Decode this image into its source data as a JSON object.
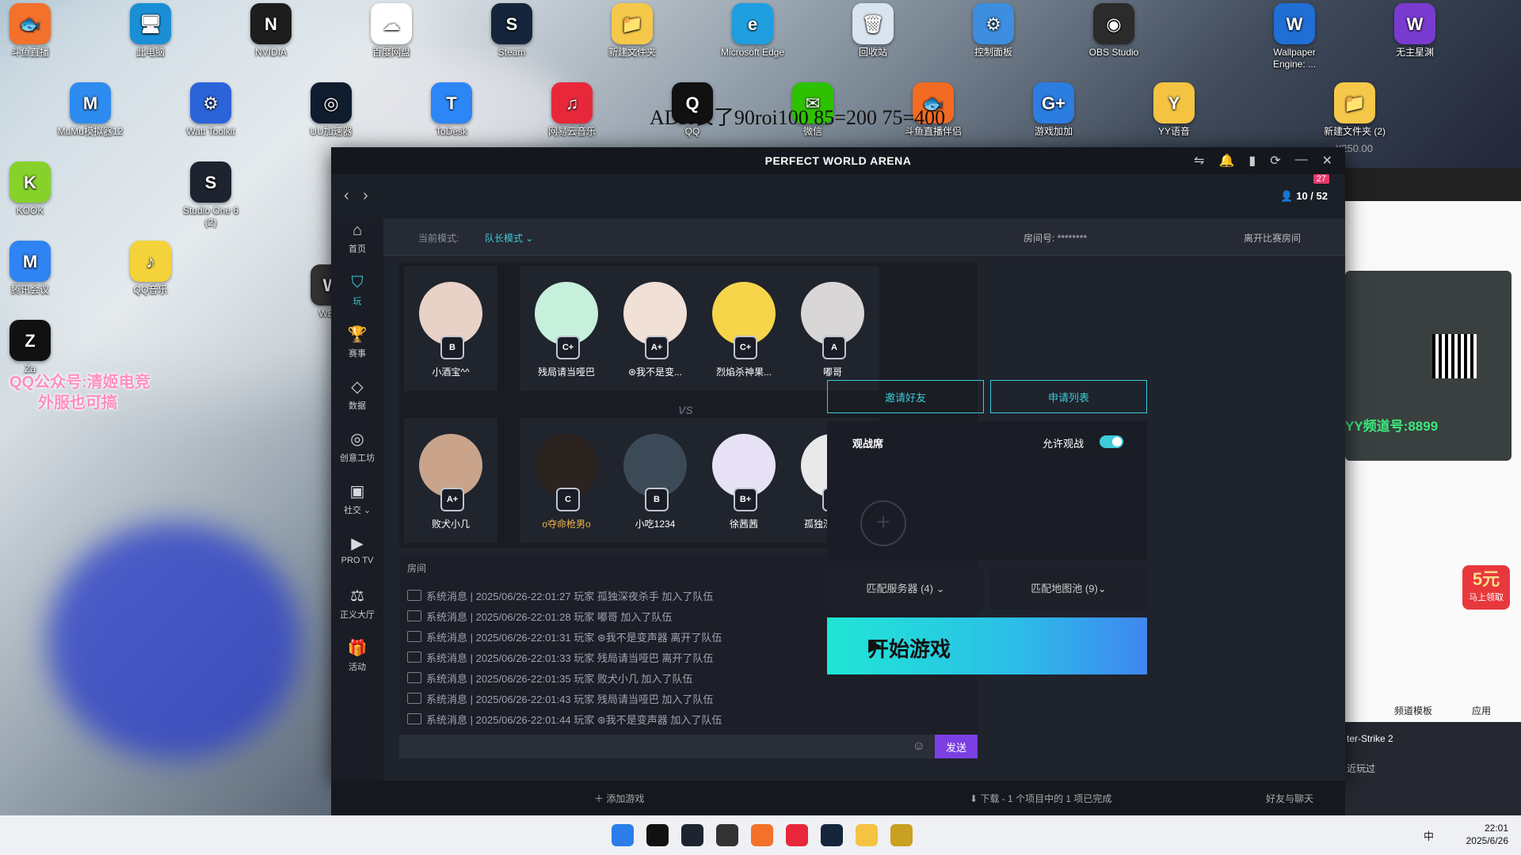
{
  "desktop": {
    "icons": [
      {
        "label": "斗鱼直播",
        "glyph": "🐟",
        "color": "#f3712b"
      },
      {
        "label": "此电脑",
        "glyph": "🖥",
        "color": "#1a8fd6"
      },
      {
        "label": "NVIDIA",
        "glyph": "N",
        "color": "#1d1d1d"
      },
      {
        "label": "百度网盘",
        "glyph": "☁",
        "color": "#ffffff"
      },
      {
        "label": "Steam",
        "glyph": "S",
        "color": "#15253b"
      },
      {
        "label": "新建文件夹",
        "glyph": "📁",
        "color": "#f5c84a"
      },
      {
        "label": "Microsoft Edge",
        "glyph": "e",
        "color": "#1f9ee0"
      },
      {
        "label": "回收站",
        "glyph": "🗑",
        "color": "#d8e4ef"
      },
      {
        "label": "控制面板",
        "glyph": "⚙",
        "color": "#3d8de0"
      },
      {
        "label": "OBS Studio",
        "glyph": "◉",
        "color": "#2b2b2b"
      },
      {
        "label": "Wallpaper Engine: ...",
        "glyph": "W",
        "color": "#1f6fd6"
      },
      {
        "label": "无主星渊",
        "glyph": "W",
        "color": "#7a3bd1"
      },
      {
        "label": "MuMu模拟器12",
        "glyph": "M",
        "color": "#2e8bf0"
      },
      {
        "label": "Watt Toolkit",
        "glyph": "⚙",
        "color": "#2b63d9"
      },
      {
        "label": "UU加速器",
        "glyph": "◎",
        "color": "#0f1c2e"
      },
      {
        "label": "ToDesk",
        "glyph": "T",
        "color": "#2c86f5"
      },
      {
        "label": "网易云音乐",
        "glyph": "♫",
        "color": "#e8283a"
      },
      {
        "label": "QQ",
        "glyph": "Q",
        "color": "#111111"
      },
      {
        "label": "微信",
        "glyph": "✉",
        "color": "#2dc100"
      },
      {
        "label": "斗鱼直播伴侣",
        "glyph": "🐟",
        "color": "#f36b22"
      },
      {
        "label": "游戏加加",
        "glyph": "G+",
        "color": "#2b7de0"
      },
      {
        "label": "YY语音",
        "glyph": "Y",
        "color": "#f5c342"
      },
      {
        "label": "新建文件夹 (2)",
        "glyph": "📁",
        "color": "#f5c84a"
      },
      {
        "label": "KOOK",
        "glyph": "K",
        "color": "#86d22a"
      },
      {
        "label": "Studio One 6 (2)",
        "glyph": "S",
        "color": "#1d2430"
      },
      {
        "label": "腾讯会议",
        "glyph": "M",
        "color": "#2f83f3"
      },
      {
        "label": "QQ音乐",
        "glyph": "♪",
        "color": "#f3d23a"
      },
      {
        "label": "WE博",
        "glyph": "W",
        "color": "#333333"
      },
      {
        "label": "Za",
        "glyph": "Z",
        "color": "#111111"
      }
    ],
    "overlay_text": "ADR长了90roi100 85=200 75=400",
    "watermark_line1": "QQ公众号:清姬电竞",
    "watermark_line2": "外服也可搞"
  },
  "app": {
    "title": "PERFECT WORLD ARENA",
    "online_count": "10 / 52",
    "notify_badge": "27",
    "sidebar": [
      {
        "label": "首页",
        "glyph": "⌂"
      },
      {
        "label": "玩",
        "glyph": "⛉"
      },
      {
        "label": "赛事",
        "glyph": "🏆"
      },
      {
        "label": "数据",
        "glyph": "◇"
      },
      {
        "label": "创意工坊",
        "glyph": "◎"
      },
      {
        "label": "社交 ⌄",
        "glyph": "▣"
      },
      {
        "label": "PRO TV",
        "glyph": "▶"
      },
      {
        "label": "正义大厅",
        "glyph": "⚖"
      },
      {
        "label": "活动",
        "glyph": "🎁"
      }
    ],
    "mode_label": "当前模式:",
    "mode_value": "队长模式 ⌄",
    "room_label": "房间号:  ********",
    "leave_label": "离开比赛房间",
    "vs": "VS",
    "team_a": [
      {
        "name": "小酒宝^^",
        "rank": "B",
        "color": "#e8d2c7"
      },
      {
        "name": "残局请当哑巴",
        "rank": "C+",
        "color": "#c6efdc"
      },
      {
        "name": "⊛我不是变...",
        "rank": "A+",
        "color": "#f1e0d6"
      },
      {
        "name": "烈焰杀神果...",
        "rank": "C+",
        "color": "#f6d54a"
      },
      {
        "name": "嘟哥",
        "rank": "A",
        "color": "#d8d6d6"
      }
    ],
    "team_b": [
      {
        "name": "败犬小几",
        "rank": "A+",
        "color": "#c9a48b"
      },
      {
        "name": "o夺命枪男o",
        "rank": "C",
        "color": "#2b2320"
      },
      {
        "name": "小吃1234",
        "rank": "B",
        "color": "#3c4a57"
      },
      {
        "name": "徐茜茜",
        "rank": "B+",
        "color": "#e7e2f6"
      },
      {
        "name": "孤独深夜杀手",
        "rank": "B+",
        "color": "#e9e9ea"
      }
    ],
    "chat_header": "房间",
    "chat": [
      "系统消息 | 2025/06/26-22:01:27 玩家 孤独深夜杀手 加入了队伍",
      "系统消息 | 2025/06/26-22:01:28 玩家 嘟哥 加入了队伍",
      "系统消息 | 2025/06/26-22:01:31 玩家 ⊛我不是变声器 离开了队伍",
      "系统消息 | 2025/06/26-22:01:33 玩家 残局请当哑巴 离开了队伍",
      "系统消息 | 2025/06/26-22:01:35 玩家 败犬小几 加入了队伍",
      "系统消息 | 2025/06/26-22:01:43 玩家 残局请当哑巴 加入了队伍",
      "系统消息 | 2025/06/26-22:01:44 玩家 ⊛我不是变声器 加入了队伍"
    ],
    "send_label": "发送",
    "invite_label": "邀请好友",
    "apply_label": "申请列表",
    "spectator_label": "观战席",
    "allow_spectate_label": "允许观战",
    "server_label": "匹配服务器 (4) ⌄",
    "mappool_label": "匹配地图池 (9)⌄",
    "start_label": "开始游戏",
    "add_game": "添加游戏",
    "download_status": "下载 - 1 个项目中的 1 项已完成",
    "friends_chat": "好友与聊天",
    "accent": "#3ecbd9",
    "send_color": "#7b3fe4"
  },
  "right_app": {
    "price": "¥250.00",
    "yy_channel": "YY频道号:8899",
    "five_yuan": "5元",
    "five_yuan_sub": "马上领取",
    "channel_template": "频道模板",
    "apps": "应用",
    "game1": "ter-Strike 2",
    "game2": "近玩过"
  },
  "taskbar": {
    "time": "22:01",
    "date": "2025/6/26",
    "ime": "中"
  }
}
